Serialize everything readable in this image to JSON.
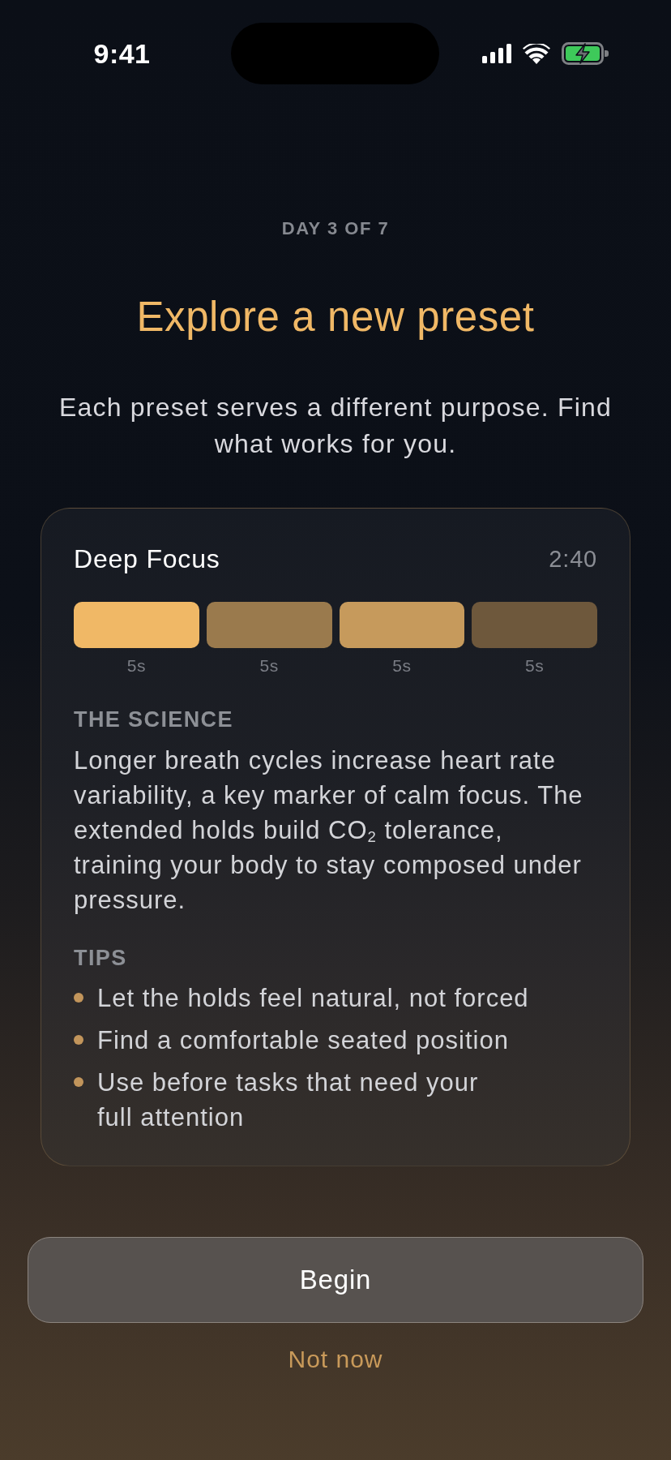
{
  "status_bar": {
    "time": "9:41"
  },
  "header": {
    "eyebrow": "DAY 3 OF 7",
    "title": "Explore a new preset",
    "subtitle": "Each preset serves a different purpose. Find what works for you."
  },
  "preset_card": {
    "name": "Deep Focus",
    "duration": "2:40",
    "phases": [
      {
        "label": "5s",
        "color": "#f0b866"
      },
      {
        "label": "5s",
        "color": "#9a7a4d"
      },
      {
        "label": "5s",
        "color": "#c69a5c"
      },
      {
        "label": "5s",
        "color": "#6e583c"
      }
    ],
    "science": {
      "heading": "THE SCIENCE",
      "text": "Longer breath cycles increase heart rate variability, a key marker of calm focus. The extended holds build CO$_{2}$ tolerance, training your body to stay composed under pressure."
    },
    "tips": {
      "heading": "TIPS",
      "items": [
        "Let the holds feel natural, not forced",
        "Find a comfortable seated position",
        "Use before tasks that need your full attention"
      ]
    }
  },
  "actions": {
    "primary": "Begin",
    "secondary": "Not now"
  }
}
